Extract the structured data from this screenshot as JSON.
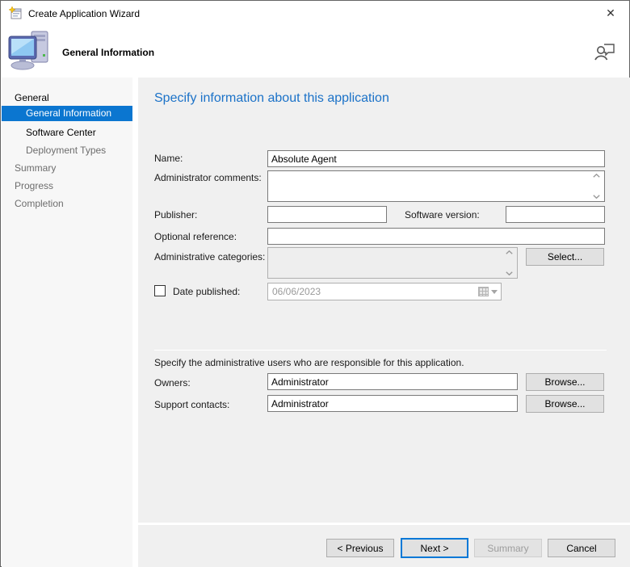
{
  "window": {
    "title": "Create Application Wizard",
    "close_glyph": "✕"
  },
  "header": {
    "title": "General Information"
  },
  "sidebar": {
    "items": [
      {
        "label": "General"
      },
      {
        "label": "General Information"
      },
      {
        "label": "Software Center"
      },
      {
        "label": "Deployment Types"
      },
      {
        "label": "Summary"
      },
      {
        "label": "Progress"
      },
      {
        "label": "Completion"
      }
    ]
  },
  "main": {
    "heading": "Specify information about this application",
    "fields": {
      "name_label": "Name:",
      "name_value": "Absolute Agent",
      "comments_label": "Administrator comments:",
      "comments_value": "",
      "publisher_label": "Publisher:",
      "publisher_value": "",
      "software_version_label": "Software version:",
      "software_version_value": "",
      "optional_reference_label": "Optional reference:",
      "optional_reference_value": "",
      "categories_label": "Administrative categories:",
      "categories_value": "",
      "select_button": "Select...",
      "date_published_label": "Date published:",
      "date_published_value": "06/06/2023",
      "admin_users_note": "Specify the administrative users who are responsible for this application.",
      "owners_label": "Owners:",
      "owners_value": "Administrator",
      "support_contacts_label": "Support contacts:",
      "support_contacts_value": "Administrator",
      "browse_button": "Browse..."
    }
  },
  "footer": {
    "previous_label": "< Previous",
    "next_label": "Next >",
    "summary_label": "Summary",
    "cancel_label": "Cancel"
  },
  "colors": {
    "selection_blue": "#0b76d0",
    "heading_blue": "#1b72c8",
    "focus_border_blue": "#0078d7"
  }
}
